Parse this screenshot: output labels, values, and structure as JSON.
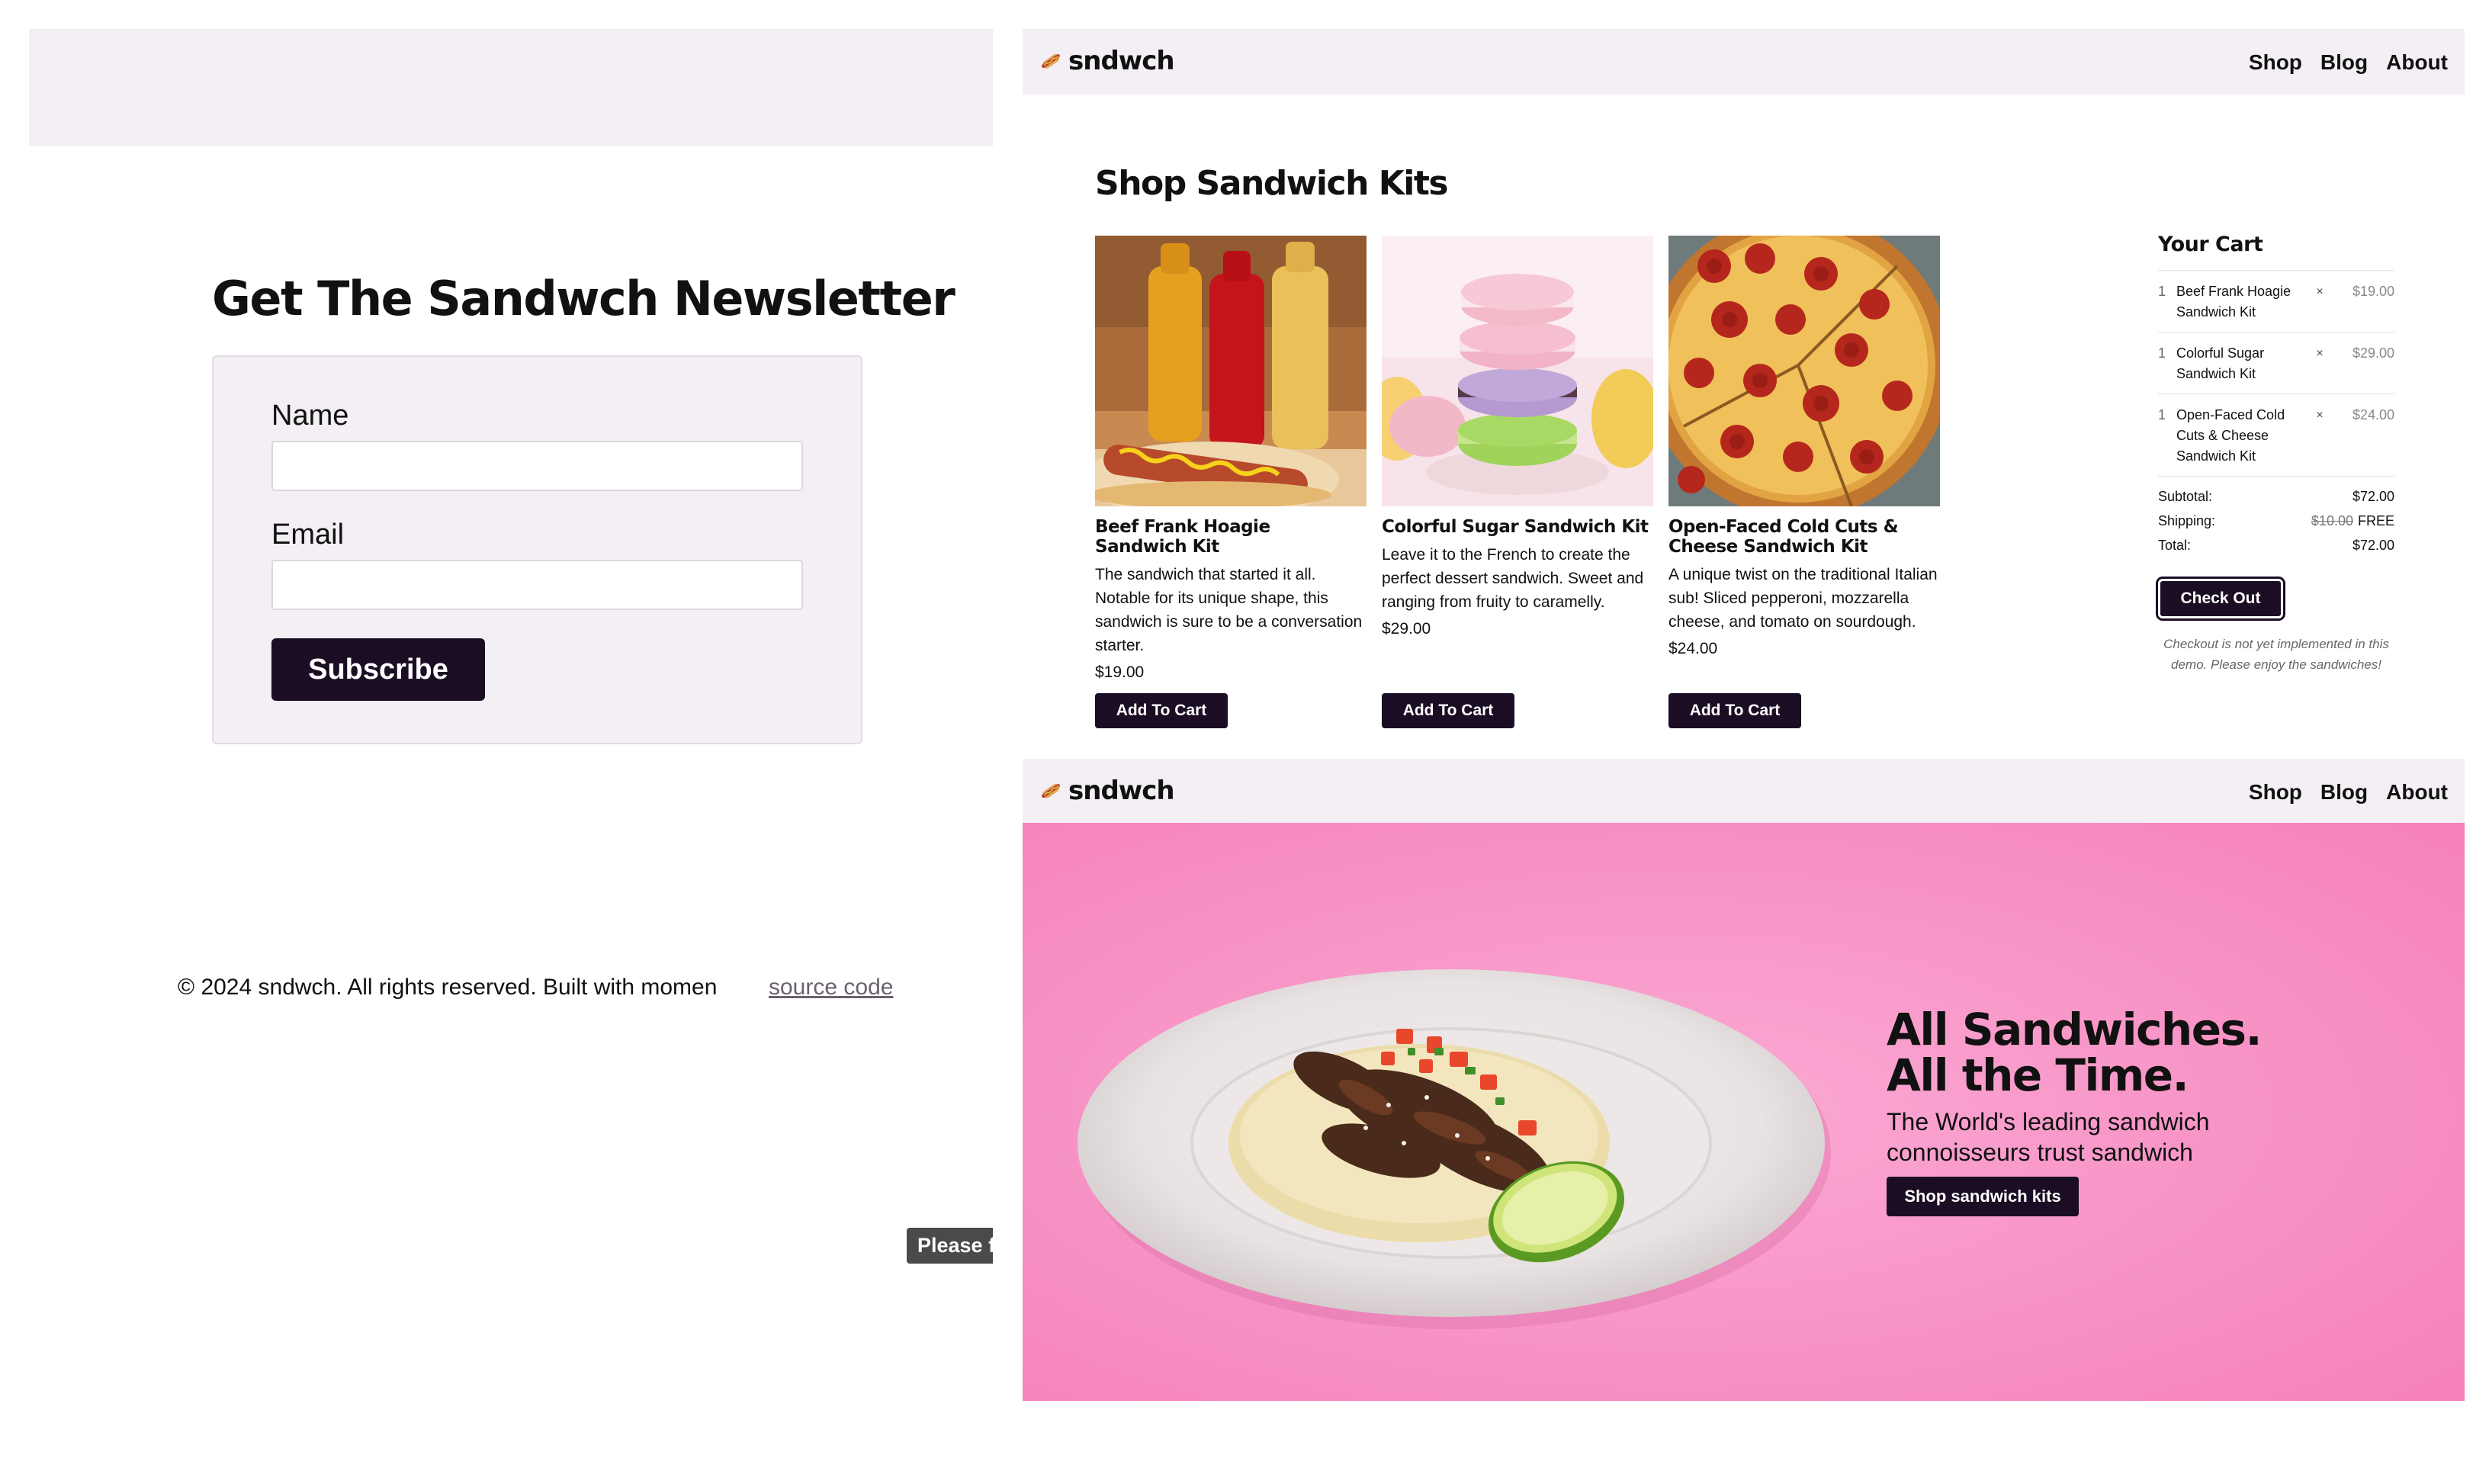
{
  "newsletter": {
    "title": "Get The Sandwch Newsletter",
    "name_label": "Name",
    "name_value": "",
    "email_label": "Email",
    "email_value": "",
    "subscribe_label": "Subscribe"
  },
  "footer": {
    "copyright": "© 2024 sndwch. All rights reserved. Built with momen",
    "source_link": "source code"
  },
  "tooltip": {
    "text": "Please f"
  },
  "nav": {
    "logo_text": "sndwch",
    "logo_icon": "hotdog-icon",
    "links": [
      "Shop",
      "Blog",
      "About"
    ]
  },
  "shop": {
    "title": "Shop Sandwich Kits",
    "products": [
      {
        "name": "Beef Frank Hoagie Sandwich Kit",
        "description": "The sandwich that started it all. Notable for its unique shape, this sandwich is sure to be a conversation starter.",
        "price": "$19.00",
        "button": "Add To Cart"
      },
      {
        "name": "Colorful Sugar Sandwich Kit",
        "description": "Leave it to the French to create the perfect dessert sandwich. Sweet and ranging from fruity to caramelly.",
        "price": "$29.00",
        "button": "Add To Cart"
      },
      {
        "name": "Open-Faced Cold Cuts & Cheese Sandwich Kit",
        "description": "A unique twist on the traditional Italian sub! Sliced pepperoni, mozzarella cheese, and tomato on sourdough.",
        "price": "$24.00",
        "button": "Add To Cart"
      }
    ]
  },
  "cart": {
    "title": "Your Cart",
    "items": [
      {
        "qty": "1",
        "name": "Beef Frank Hoagie Sandwich Kit",
        "remove": "×",
        "price": "$19.00"
      },
      {
        "qty": "1",
        "name": "Colorful Sugar Sandwich Kit",
        "remove": "×",
        "price": "$29.00"
      },
      {
        "qty": "1",
        "name": "Open-Faced Cold Cuts & Cheese Sandwich Kit",
        "remove": "×",
        "price": "$24.00"
      }
    ],
    "subtotal_label": "Subtotal:",
    "subtotal": "$72.00",
    "shipping_label": "Shipping:",
    "shipping_original": "$10.00",
    "shipping": "FREE",
    "total_label": "Total:",
    "total": "$72.00",
    "checkout_label": "Check Out",
    "note": "Checkout is not yet implemented in this demo. Please enjoy the sandwiches!"
  },
  "hero": {
    "title_line1": "All Sandwiches.",
    "title_line2": "All the Time.",
    "subtitle": "The World's leading sandwich connoisseurs trust sandwich",
    "button": "Shop sandwich kits"
  },
  "colors": {
    "nav_bg": "#f3eff4",
    "button_bg": "#1b0e24",
    "hero_pink": "#f78cc4"
  }
}
